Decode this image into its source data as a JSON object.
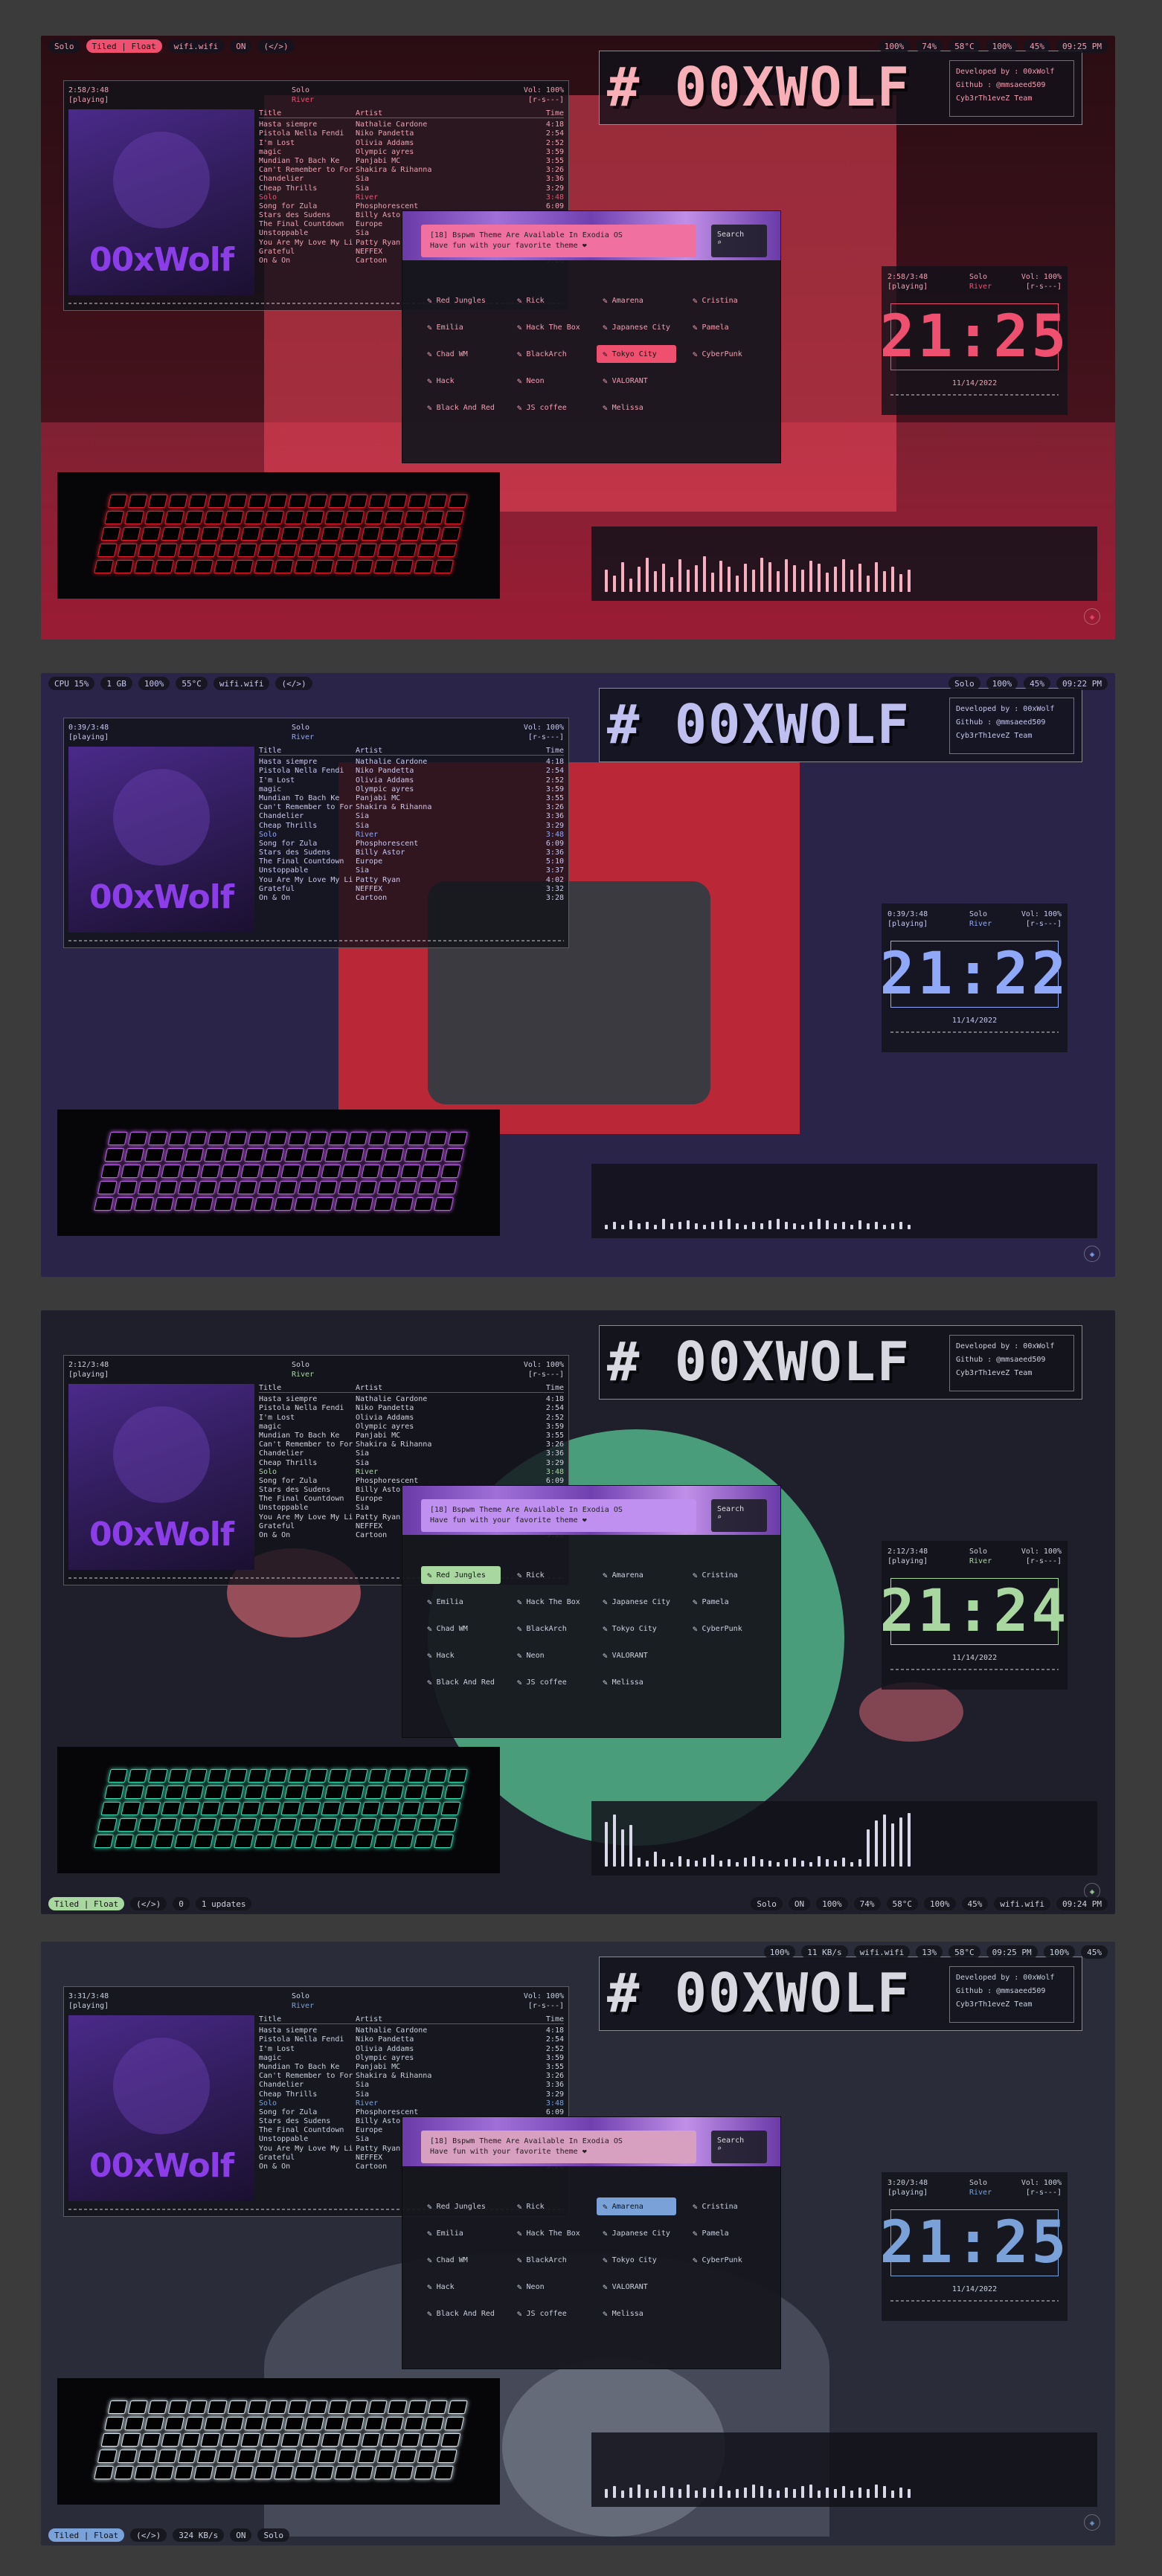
{
  "shots": [
    {
      "accent": "#f05070",
      "text_color": "#f0a0b0",
      "topbar_left": [
        "Solo",
        "Tiled | Float",
        "wifi.wifi",
        "ON"
      ],
      "topbar_center": "(</>)",
      "topbar_right": [
        "100%",
        "74%",
        "58°C",
        "100%",
        "45%",
        "09:25 PM"
      ],
      "player": {
        "time": "2:58/3:48",
        "state": "[playing]",
        "artist": "Solo",
        "track": "River",
        "vol": "Vol: 100%",
        "flags": "[r-s---]"
      },
      "clock": {
        "time": "2:58/3:48",
        "state": "[playing]",
        "artist": "Solo",
        "track": "River",
        "vol": "Vol: 100%",
        "flags": "[r-s---]",
        "digits": "21:25",
        "date": "11/14/2022"
      },
      "selected_theme": "Tokyo City"
    },
    {
      "accent": "#8fa8f8",
      "text_color": "#c8c8f0",
      "topbar_left": [
        "CPU 15%",
        "1 GB",
        "100%",
        "55°C",
        "wifi.wifi"
      ],
      "topbar_center": "(</>)",
      "topbar_right": [
        "Solo",
        "100%",
        "45%",
        "09:22 PM"
      ],
      "player": {
        "time": "0:39/3:48",
        "state": "[playing]",
        "artist": "Solo",
        "track": "River",
        "vol": "Vol: 100%",
        "flags": "[r-s---]"
      },
      "clock": {
        "time": "0:39/3:48",
        "state": "[playing]",
        "artist": "Solo",
        "track": "River",
        "vol": "Vol: 100%",
        "flags": "[r-s---]",
        "digits": "21:22",
        "date": "11/14/2022"
      },
      "selected_theme": ""
    },
    {
      "accent": "#a8d8a0",
      "text_color": "#d0d0e0",
      "bottombar_left": [
        "Tiled | Float",
        "(</>)",
        "0",
        "1 updates"
      ],
      "bottombar_right": [
        "Solo",
        "ON",
        "100%",
        "74%",
        "58°C",
        "100%",
        "45%",
        "wifi.wifi",
        "09:24 PM"
      ],
      "player": {
        "time": "2:12/3:48",
        "state": "[playing]",
        "artist": "Solo",
        "track": "River",
        "vol": "Vol: 100%",
        "flags": "[r-s---]"
      },
      "clock": {
        "time": "2:12/3:48",
        "state": "[playing]",
        "artist": "Solo",
        "track": "River",
        "vol": "Vol: 100%",
        "flags": "[r-s---]",
        "digits": "21:24",
        "date": "11/14/2022"
      },
      "selected_theme": "Red Jungles"
    },
    {
      "accent": "#7aa2d8",
      "text_color": "#c8d0e0",
      "topbar_right": [
        "100%",
        "11 KB/s",
        "wifi.wifi",
        "13%",
        "58°C",
        "09:25 PM",
        "100%",
        "45%"
      ],
      "bottombar_left": [
        "Tiled | Float",
        "(</>)",
        "324 KB/s",
        "ON",
        "Solo"
      ],
      "player": {
        "time": "3:31/3:48",
        "state": "[playing]",
        "artist": "Solo",
        "track": "River",
        "vol": "Vol: 100%",
        "flags": "[r-s---]"
      },
      "clock": {
        "time": "3:20/3:48",
        "state": "[playing]",
        "artist": "Solo",
        "track": "River",
        "vol": "Vol: 100%",
        "flags": "[r-s---]",
        "digits": "21:25",
        "date": "11/14/2022"
      },
      "selected_theme": "Amarena"
    }
  ],
  "player_headers": {
    "title": "Title",
    "artist": "Artist",
    "time": "Time"
  },
  "playlist": [
    {
      "title": "Hasta siempre",
      "artist": "Nathalie Cardone",
      "time": "4:18"
    },
    {
      "title": "Pistola Nella Fendi",
      "artist": "Niko Pandetta",
      "time": "2:54"
    },
    {
      "title": "I'm Lost",
      "artist": "Olivia Addams",
      "time": "2:52"
    },
    {
      "title": "magic",
      "artist": "Olympic ayres",
      "time": "3:59"
    },
    {
      "title": "Mundian To Bach Ke",
      "artist": "Panjabi MC",
      "time": "3:55"
    },
    {
      "title": "Can't Remember to For",
      "artist": "Shakira & Rihanna",
      "time": "3:26"
    },
    {
      "title": "Chandelier",
      "artist": "Sia",
      "time": "3:36"
    },
    {
      "title": "Cheap Thrills",
      "artist": "Sia",
      "time": "3:29"
    },
    {
      "title": "Solo",
      "artist": "River",
      "time": "3:48"
    },
    {
      "title": "Song for Zula",
      "artist": "Phosphorescent",
      "time": "6:09"
    },
    {
      "title": "Stars des Sudens",
      "artist": "Billy Astor",
      "time": "3:36"
    },
    {
      "title": "The Final Countdown",
      "artist": "Europe",
      "time": "5:10"
    },
    {
      "title": "Unstoppable",
      "artist": "Sia",
      "time": "3:37"
    },
    {
      "title": "You Are My Love My Li",
      "artist": "Patty Ryan",
      "time": "4:02"
    },
    {
      "title": "Grateful",
      "artist": "NEFFEX",
      "time": "3:32"
    },
    {
      "title": "On & On",
      "artist": "Cartoon",
      "time": "3:28"
    }
  ],
  "brand": {
    "title": "# 00XWOLF",
    "dev": "Developed by : 00xWolf",
    "github": "Github : @mmsaeed509",
    "team": "Cyb3rTh1eveZ Team",
    "cover_logo": "00xWolf"
  },
  "switcher": {
    "message_line1": "[18] Bspwm Theme Are Available In Exodia OS",
    "message_line2": "Have fun with your favorite theme ❤",
    "search_label": "Search",
    "themes": [
      "Red Jungles",
      "Rick",
      "Amarena",
      "Cristina",
      "Emilia",
      "Hack The Box",
      "Japanese City",
      "Pamela",
      "Chad WM",
      "BlackArch",
      "Tokyo City",
      "CyberPunk",
      "Hack",
      "Neon",
      "VALORANT",
      "",
      "Black And Red",
      "JS coffee",
      "Melissa",
      ""
    ]
  },
  "icons": {
    "music": "music-note-icon",
    "wolf": "wolf-icon",
    "search": "search-icon",
    "wifi": "wifi-icon",
    "battery": "battery-icon",
    "temp": "thermometer-icon",
    "clock": "clock-icon",
    "cpu": "cpu-icon",
    "ram": "ram-icon",
    "volume": "volume-icon"
  }
}
